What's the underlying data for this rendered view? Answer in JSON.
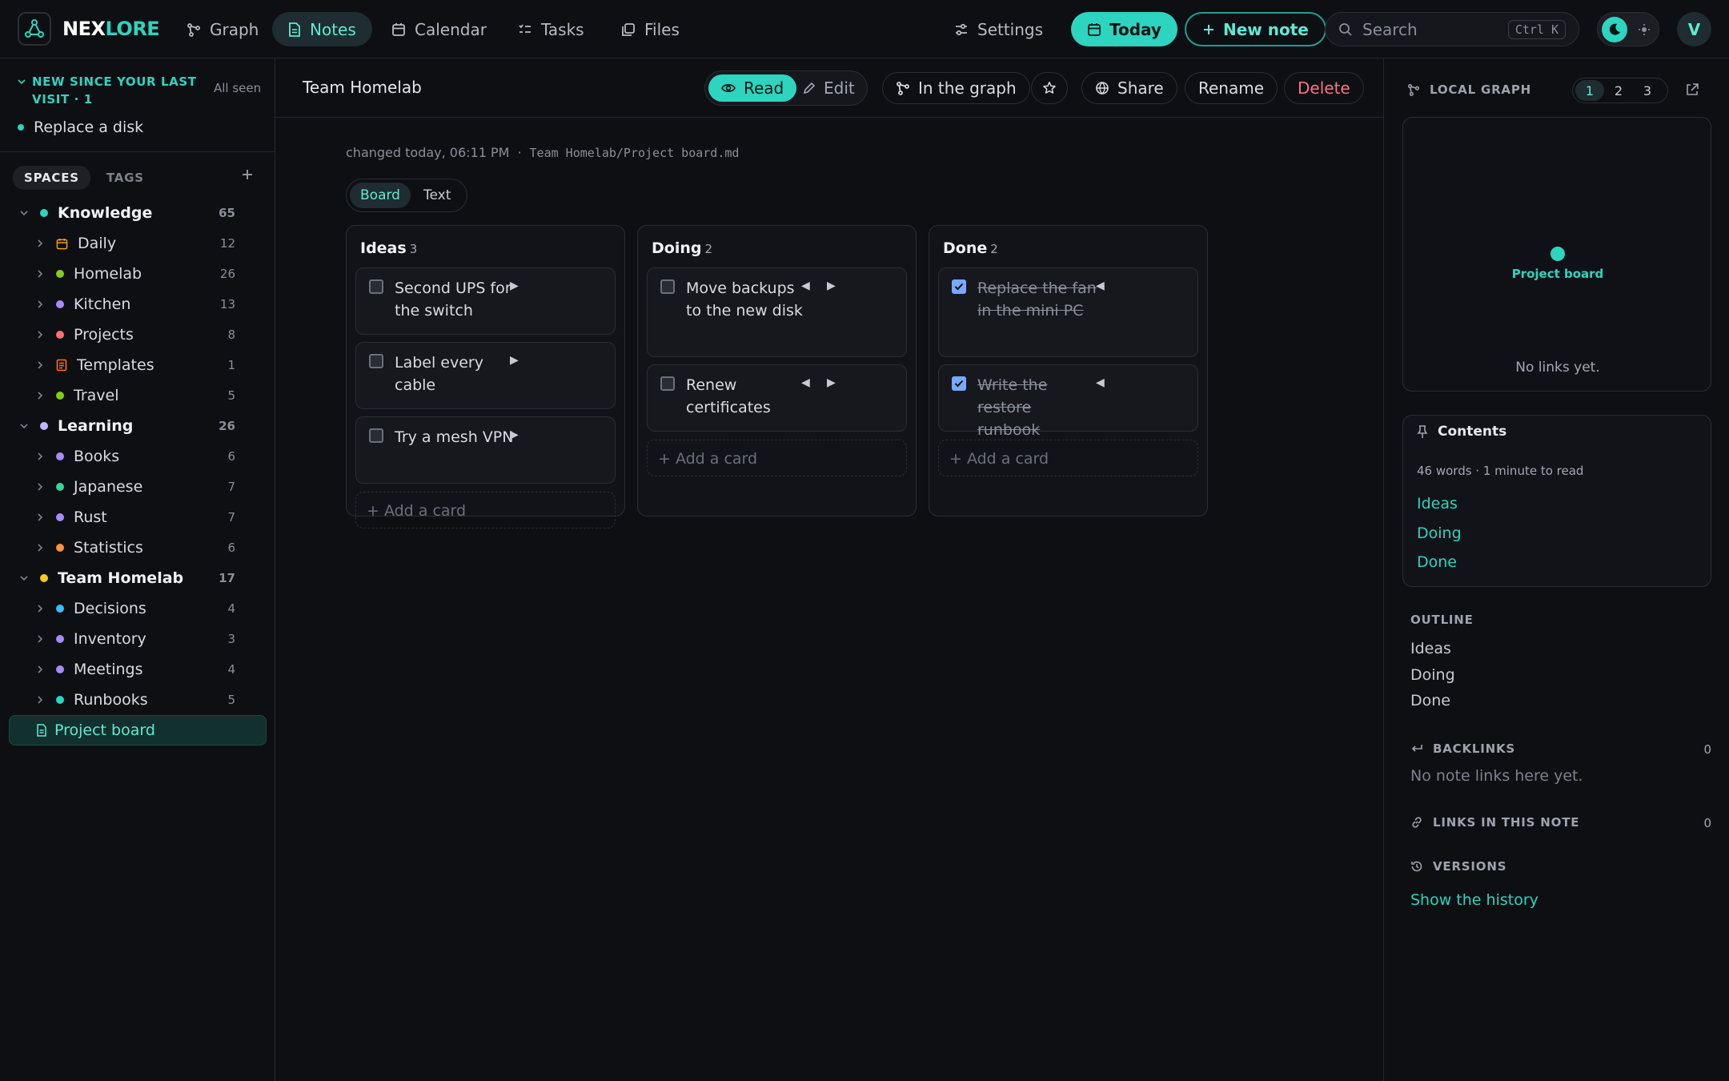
{
  "app": {
    "logo_part1": "NEX",
    "logo_part2": "LORE",
    "accent_color": "#2dd4bf"
  },
  "topbar": {
    "nav": [
      {
        "label": "Graph",
        "icon": "graph-icon"
      },
      {
        "label": "Notes",
        "icon": "note-icon",
        "active": true
      },
      {
        "label": "Calendar",
        "icon": "calendar-icon"
      },
      {
        "label": "Tasks",
        "icon": "tasks-icon"
      },
      {
        "label": "Files",
        "icon": "files-icon"
      }
    ],
    "settings_label": "Settings",
    "today_label": "Today",
    "new_note_label": "New note",
    "search_placeholder": "Search",
    "search_shortcut": "Ctrl K",
    "avatar_initial": "V"
  },
  "sidebar": {
    "new_since_title": "NEW SINCE YOUR LAST VISIT · 1",
    "all_seen_label": "All seen",
    "new_items": [
      {
        "label": "Replace a disk"
      }
    ],
    "tabs": {
      "spaces": "SPACES",
      "tags": "TAGS"
    },
    "tree": [
      {
        "label": "Knowledge",
        "count": "65",
        "color": "#2dd4bf"
      },
      {
        "label": "Daily",
        "count": "12",
        "icon": "calendar-icon"
      },
      {
        "label": "Homelab",
        "count": "26",
        "color": "#84cc16"
      },
      {
        "label": "Kitchen",
        "count": "13",
        "color": "#a78bfa"
      },
      {
        "label": "Projects",
        "count": "8",
        "color": "#f87171"
      },
      {
        "label": "Templates",
        "count": "1",
        "icon": "template-icon"
      },
      {
        "label": "Travel",
        "count": "5",
        "color": "#84cc16"
      },
      {
        "label": "Learning",
        "count": "26",
        "color": "#c4b5fd"
      },
      {
        "label": "Books",
        "count": "6",
        "color": "#a78bfa"
      },
      {
        "label": "Japanese",
        "count": "7",
        "color": "#34d399"
      },
      {
        "label": "Rust",
        "count": "7",
        "color": "#a78bfa"
      },
      {
        "label": "Statistics",
        "count": "6",
        "color": "#fb923c"
      },
      {
        "label": "Team Homelab",
        "count": "17",
        "color": "#facc15"
      },
      {
        "label": "Decisions",
        "count": "4",
        "color": "#38bdf8"
      },
      {
        "label": "Inventory",
        "count": "3",
        "color": "#a78bfa"
      },
      {
        "label": "Meetings",
        "count": "4",
        "color": "#a78bfa"
      },
      {
        "label": "Runbooks",
        "count": "5",
        "color": "#2dd4bf"
      },
      {
        "label": "Project board"
      }
    ]
  },
  "main": {
    "title": "Team Homelab",
    "read_label": "Read",
    "edit_label": "Edit",
    "in_graph_label": "In the graph",
    "share_label": "Share",
    "rename_label": "Rename",
    "delete_label": "Delete",
    "changed_label": "changed today, 06:11 PM",
    "separator": "·",
    "path": "Team Homelab/Project board.md",
    "view_board": "Board",
    "view_text": "Text",
    "add_card_label": "+ Add a card",
    "columns": [
      {
        "title": "Ideas",
        "count": "3",
        "cards": [
          {
            "text": "Second UPS for the switch",
            "done": false
          },
          {
            "text": "Label every cable",
            "done": false
          },
          {
            "text": "Try a mesh VPN",
            "done": false
          }
        ]
      },
      {
        "title": "Doing",
        "count": "2",
        "cards": [
          {
            "text": "Move backups to the new disk",
            "done": false
          },
          {
            "text": "Renew certificates",
            "done": false
          }
        ]
      },
      {
        "title": "Done",
        "count": "2",
        "cards": [
          {
            "text": "Replace the fan in the mini PC",
            "done": true
          },
          {
            "text": "Write the restore runbook",
            "done": true
          }
        ]
      }
    ]
  },
  "right": {
    "local_graph_label": "LOCAL GRAPH",
    "depth": [
      "1",
      "2",
      "3"
    ],
    "graph_node_label": "Project board",
    "graph_empty": "No links yet.",
    "contents_title": "Contents",
    "contents_meta": "46 words · 1 minute to read",
    "contents_links": [
      "Ideas",
      "Doing",
      "Done"
    ],
    "outline_label": "OUTLINE",
    "outline": [
      "Ideas",
      "Doing",
      "Done"
    ],
    "backlinks_label": "BACKLINKS",
    "backlinks_count": "0",
    "backlinks_empty": "No note links here yet.",
    "links_label": "LINKS IN THIS NOTE",
    "links_count": "0",
    "versions_label": "VERSIONS",
    "show_history_label": "Show the history"
  }
}
